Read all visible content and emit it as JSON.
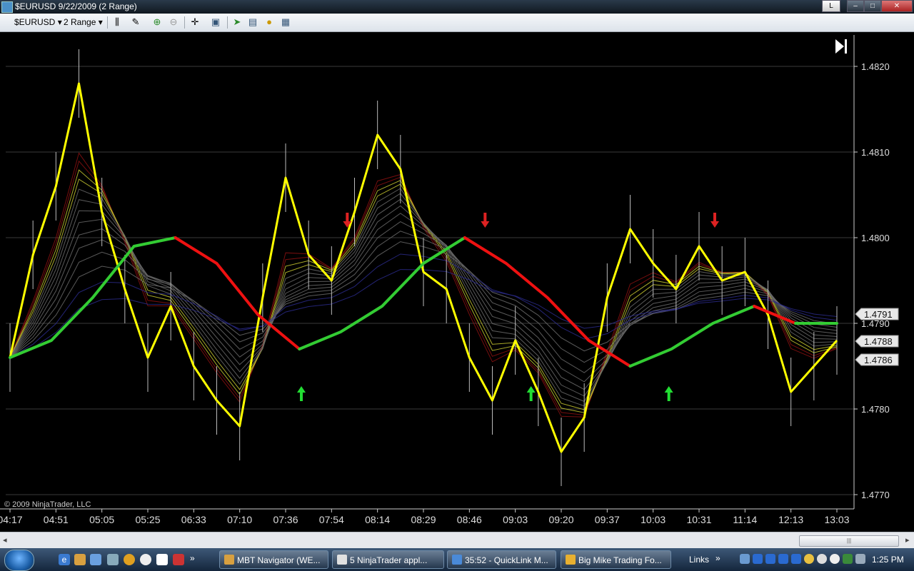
{
  "window": {
    "title": "$EURUSD  9/22/2009 (2 Range)",
    "btn_l": "L",
    "btn_min": "‒",
    "btn_max": "□",
    "btn_close": "✕"
  },
  "toolbar": {
    "instrument": "$EURUSD",
    "interval": "2 Range",
    "icons": [
      "bar-type-icon",
      "draw-pencil-icon",
      "zoom-in-icon",
      "zoom-out-icon",
      "crosshair-icon",
      "snapshot-icon",
      "indicators-icon",
      "strategies-icon",
      "gold-coin-icon",
      "data-box-icon"
    ]
  },
  "chart_data": {
    "type": "line",
    "instrument": "$EURUSD",
    "period": "2 Range",
    "ylim": [
      1.4768,
      1.483
    ],
    "y_ticks": [
      "1.4820",
      "1.4810",
      "1.4800",
      "1.4790",
      "1.4780",
      "1.4770"
    ],
    "x_ticks": [
      "04:17",
      "04:51",
      "05:05",
      "05:25",
      "06:33",
      "07:10",
      "07:36",
      "07:54",
      "08:14",
      "08:29",
      "08:46",
      "09:03",
      "09:20",
      "09:37",
      "10:03",
      "10:31",
      "11:14",
      "12:13",
      "13:03"
    ],
    "price_labels": [
      "1.4791",
      "1.4788",
      "1.4786"
    ],
    "series": [
      {
        "color": "#ffff00",
        "values": [
          1.4786,
          1.4798,
          1.4806,
          1.4818,
          1.4803,
          1.4794,
          1.4786,
          1.4792,
          1.4785,
          1.4781,
          1.4778,
          1.4793,
          1.4807,
          1.4798,
          1.4795,
          1.4803,
          1.4812,
          1.4808,
          1.4796,
          1.4794,
          1.4786,
          1.4781,
          1.4788,
          1.4782,
          1.4775,
          1.4779,
          1.4793,
          1.4801,
          1.4797,
          1.4794,
          1.4799,
          1.4795,
          1.4796,
          1.4791,
          1.4782,
          1.4785,
          1.4788
        ]
      },
      {
        "color": "#33cc33",
        "values": [
          1.4786,
          1.4788,
          1.4793,
          1.4799,
          1.48
        ]
      },
      {
        "color": "#ee1111",
        "values": [
          1.48,
          1.4797,
          1.4791,
          1.4787
        ]
      },
      {
        "color": "#33cc33",
        "values": [
          1.4787,
          1.4789,
          1.4792,
          1.4797,
          1.48
        ]
      },
      {
        "color": "#ee1111",
        "values": [
          1.48,
          1.4797,
          1.4793,
          1.4788,
          1.4785
        ]
      },
      {
        "color": "#33cc33",
        "values": [
          1.4785,
          1.4787,
          1.479,
          1.4792
        ]
      },
      {
        "color": "#ee1111",
        "values": [
          1.4792,
          1.479
        ]
      },
      {
        "color": "#33cc33",
        "values": [
          1.479,
          1.479
        ]
      }
    ],
    "signals": [
      {
        "type": "down",
        "at": "07:54"
      },
      {
        "type": "down",
        "at": "08:46"
      },
      {
        "type": "down",
        "at": "10:31"
      },
      {
        "type": "up",
        "at": "07:36"
      },
      {
        "type": "up",
        "at": "09:03"
      },
      {
        "type": "up",
        "at": "10:03"
      }
    ],
    "copyright": "© 2009 NinjaTrader, LLC"
  },
  "scrollbar": {
    "left_arrow": "◂",
    "right_arrow": "▸",
    "grip": "|||"
  },
  "taskbar": {
    "tasks": [
      {
        "label": "MBT Navigator (WE...",
        "color": "#d8a040"
      },
      {
        "label": "5 NinjaTrader appl...",
        "color": "#e0e0e0"
      },
      {
        "label": "35:52 - QuickLink M...",
        "color": "#4a8ad8"
      },
      {
        "label": "Big Mike Trading Fo...",
        "color": "#e8b030"
      }
    ],
    "links_label": "Links",
    "chevron": "»",
    "clock": "1:25 PM"
  }
}
